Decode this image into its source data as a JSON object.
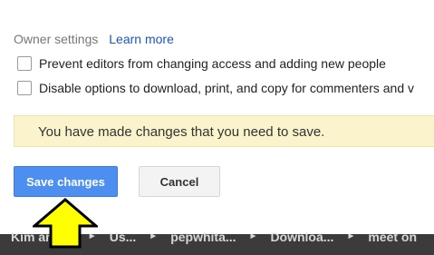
{
  "owner_settings": {
    "label": "Owner settings",
    "learn_more": "Learn more"
  },
  "options": [
    {
      "label": "Prevent editors from changing access and adding new people",
      "checked": false
    },
    {
      "label": "Disable options to download, print, and copy for commenters and v",
      "checked": false
    }
  ],
  "notice": {
    "text": "You have made changes that you need to save.",
    "background": "#fbf3cb"
  },
  "buttons": {
    "save": "Save changes",
    "cancel": "Cancel",
    "save_color": "#4d8ff0"
  },
  "pointer_arrow": {
    "icon": "up-arrow-icon",
    "color": "#ffff00"
  },
  "breadcrumbs": [
    "Kim and ...",
    "Us...",
    "pepwhita...",
    "Downloa...",
    "meet on"
  ],
  "breadcrumb_separator": "►"
}
